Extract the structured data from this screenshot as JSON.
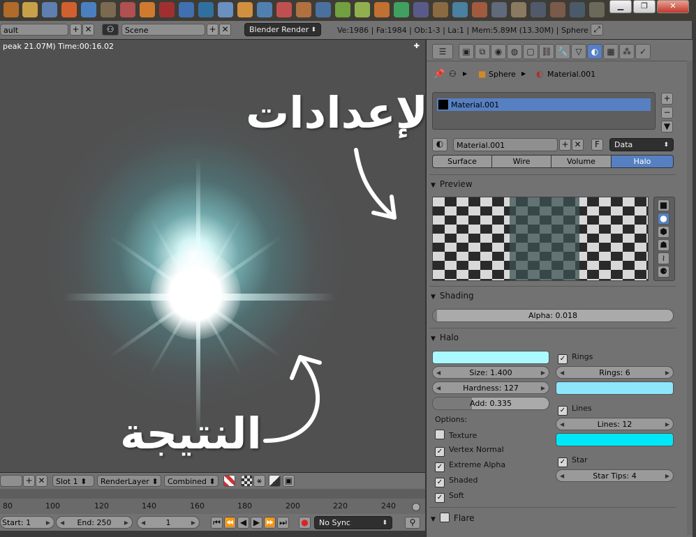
{
  "header": {
    "layout_name": "ault",
    "scene_name": "Scene",
    "render_engine": "Blender Render",
    "stats": "Ve:1986 | Fa:1984 | Ob:1-3 | La:1 | Mem:5.89M (13.30M) | Sphere"
  },
  "window": {
    "minimize": "▁",
    "maximize": "❐",
    "close": "✕"
  },
  "viewport": {
    "info": "peak 21.07M) Time:00:16.02",
    "annotation_settings": "الإعدادات",
    "annotation_result": "النتيجة"
  },
  "image_header": {
    "slot": "Slot 1",
    "render_layer": "RenderLayer",
    "pass": "Combined"
  },
  "timeline": {
    "ticks": [
      "80",
      "100",
      "120",
      "140",
      "160",
      "180",
      "200",
      "220",
      "240"
    ],
    "start": "Start: 1",
    "end": "End: 250",
    "current": "1",
    "sync": "No Sync"
  },
  "properties": {
    "breadcrumb_object": "Sphere",
    "breadcrumb_material": "Material.001",
    "slot_material": "Material.001",
    "material_name": "Material.001",
    "link": "Data",
    "types": [
      "Surface",
      "Wire",
      "Volume",
      "Halo"
    ],
    "active_type": "Halo",
    "preview_title": "Preview",
    "shading_title": "Shading",
    "alpha": "Alpha: 0.018",
    "alpha_value": 0.018,
    "halo_title": "Halo",
    "size": "Size: 1.400",
    "hardness": "Hardness: 127",
    "add": "Add: 0.335",
    "add_value": 0.335,
    "options_label": "Options:",
    "options": [
      "Texture",
      "Vertex Normal",
      "Extreme Alpha",
      "Shaded",
      "Soft"
    ],
    "options_checked": [
      false,
      true,
      true,
      true,
      true
    ],
    "rings_label": "Rings",
    "rings": "Rings: 6",
    "lines_label": "Lines",
    "lines": "Lines: 12",
    "star_label": "Star",
    "star_tips": "Star Tips: 4",
    "flare_title": "Flare",
    "colors": {
      "halo": "#aaf9ff",
      "rings": "#8ee6fb",
      "lines": "#00e8f7",
      "accent": "#5680c2"
    }
  }
}
